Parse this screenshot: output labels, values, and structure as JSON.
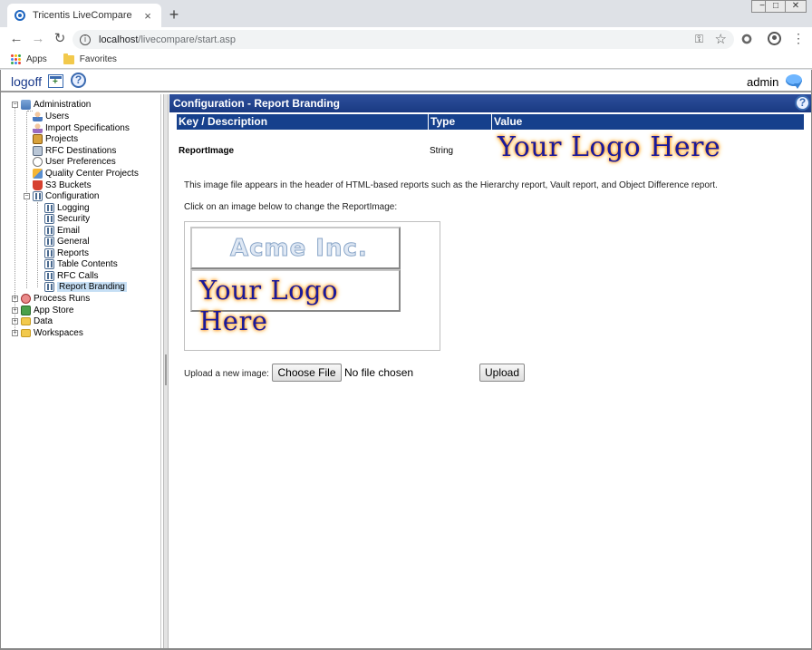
{
  "browser": {
    "tab_title": "Tricentis LiveCompare",
    "tab_close": "×",
    "new_tab": "+",
    "url_host": "localhost",
    "url_path": "/livecompare/start.asp",
    "bookmarks": [
      {
        "label": "Apps",
        "icon": "apps-grid-icon"
      },
      {
        "label": "Favorites",
        "icon": "folder-icon"
      }
    ],
    "window_controls": {
      "minimize": "−",
      "maximize": "□",
      "close": "✕"
    }
  },
  "app_header": {
    "logoff_label": "logoff",
    "username": "admin"
  },
  "tree": {
    "items": [
      {
        "label": "Administration",
        "icon": "administration-icon"
      },
      {
        "label": "Users",
        "icon": "users-icon"
      },
      {
        "label": "Import Specifications",
        "icon": "import-icon"
      },
      {
        "label": "Projects",
        "icon": "projects-icon"
      },
      {
        "label": "RFC Destinations",
        "icon": "rfc-icon"
      },
      {
        "label": "User Preferences",
        "icon": "preferences-icon"
      },
      {
        "label": "Quality Center Projects",
        "icon": "quality-center-icon"
      },
      {
        "label": "S3 Buckets",
        "icon": "s3-bucket-icon"
      },
      {
        "label": "Configuration",
        "icon": "configuration-icon"
      },
      {
        "label": "Logging",
        "icon": "configuration-icon"
      },
      {
        "label": "Security",
        "icon": "configuration-icon"
      },
      {
        "label": "Email",
        "icon": "configuration-icon"
      },
      {
        "label": "General",
        "icon": "configuration-icon"
      },
      {
        "label": "Reports",
        "icon": "configuration-icon"
      },
      {
        "label": "Table Contents",
        "icon": "configuration-icon"
      },
      {
        "label": "RFC Calls",
        "icon": "configuration-icon"
      },
      {
        "label": "Report Branding",
        "icon": "configuration-icon",
        "selected": true
      },
      {
        "label": "Process Runs",
        "icon": "process-runs-icon"
      },
      {
        "label": "App Store",
        "icon": "app-store-icon"
      },
      {
        "label": "Data",
        "icon": "folder-icon"
      },
      {
        "label": "Workspaces",
        "icon": "folder-icon"
      }
    ]
  },
  "main": {
    "title": "Configuration - Report Branding",
    "table": {
      "columns": [
        "Key / Description",
        "Type",
        "Value"
      ],
      "row": {
        "key": "ReportImage",
        "type": "String",
        "value_image_text": "Your Logo Here"
      }
    },
    "description": "This image file appears in the header of HTML-based reports such as the Hierarchy report, Vault report, and Object Difference report.",
    "click_hint": "Click on an image below to change the ReportImage:",
    "image_choices": [
      {
        "text": "Acme Inc."
      },
      {
        "text": "Your Logo Here"
      }
    ],
    "upload_label": "Upload a new image:",
    "choose_file_label": "Choose File",
    "no_file_label": "No file chosen",
    "upload_button_label": "Upload"
  },
  "colors": {
    "header_blue": "#1a3a82",
    "table_header_blue": "#16408c",
    "selection": "#c6dff5"
  }
}
